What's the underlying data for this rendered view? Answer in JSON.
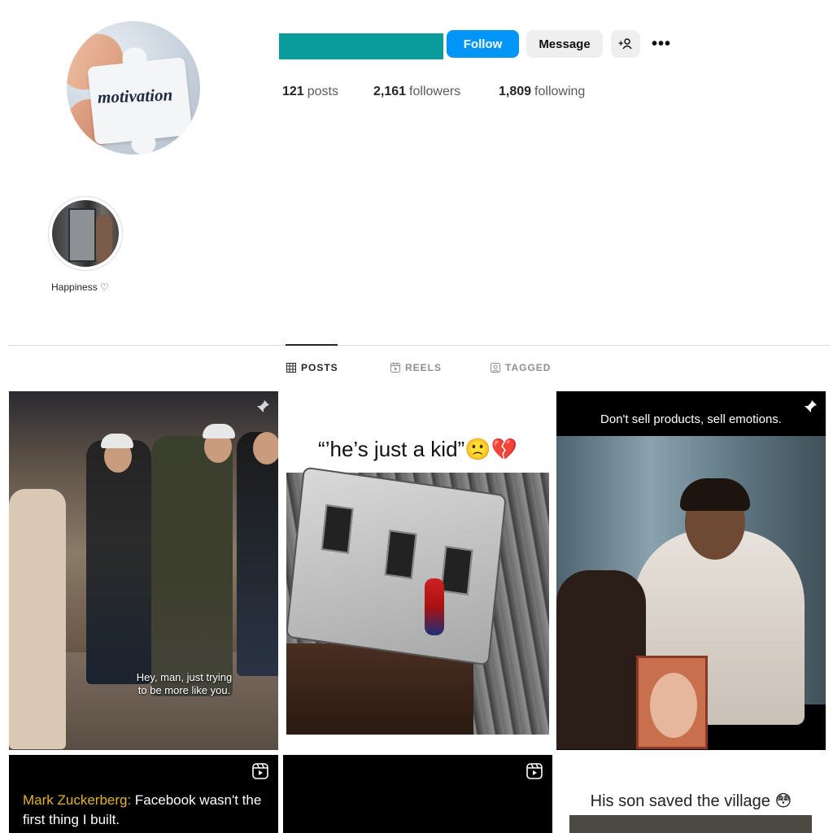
{
  "profile": {
    "avatar_text": "motivation",
    "follow_label": "Follow",
    "message_label": "Message",
    "add_user_icon": "+👤",
    "more_icon": "•••"
  },
  "stats": {
    "posts_count": "121",
    "posts_label": "posts",
    "followers_count": "2,161",
    "followers_label": "followers",
    "following_count": "1,809",
    "following_label": "following"
  },
  "highlight": {
    "label": "Happiness ♡"
  },
  "tabs": [
    {
      "label": "POSTS",
      "icon": "grid-icon"
    },
    {
      "label": "REELS",
      "icon": "reels-icon"
    },
    {
      "label": "TAGGED",
      "icon": "tagged-icon"
    }
  ],
  "posts": [
    {
      "subtitle_line1": "Hey, man, just trying",
      "subtitle_line2": "to be more like you.",
      "pinned": true
    },
    {
      "caption": "“’he’s just a kid”🙁💔"
    },
    {
      "caption": "Don't sell products, sell emotions.",
      "pinned": true
    },
    {
      "name": "Mark Zuckerberg:",
      "text": " Facebook wasn't the first thing I built.",
      "type": "reel"
    },
    {
      "type": "reel"
    },
    {
      "caption": "His son saved the village 😳"
    }
  ],
  "colors": {
    "accent": "#0095f6",
    "username_redaction": "#0a9b9b"
  }
}
